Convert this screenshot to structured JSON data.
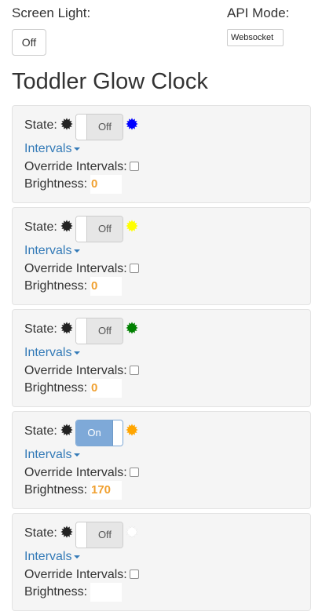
{
  "header": {
    "screen_light_label": "Screen Light:",
    "screen_light_value": "Off",
    "api_mode_label": "API Mode:",
    "api_mode_value": "Websocket"
  },
  "title": "Toddler Glow Clock",
  "labels": {
    "state": "State:",
    "intervals": "Intervals",
    "override": "Override Intervals:",
    "brightness": "Brightness:"
  },
  "icons": {
    "state_icon": "sun-icon",
    "color_icon": "color-sun-icon",
    "dropdown_icon": "caret-down-icon"
  },
  "lights": [
    {
      "state": "Off",
      "on": false,
      "color": "#0000ff",
      "override": false,
      "brightness": "0"
    },
    {
      "state": "Off",
      "on": false,
      "color": "#ffff00",
      "override": false,
      "brightness": "0"
    },
    {
      "state": "Off",
      "on": false,
      "color": "#008000",
      "override": false,
      "brightness": "0"
    },
    {
      "state": "On",
      "on": true,
      "color": "#ffa500",
      "override": false,
      "brightness": "170"
    },
    {
      "state": "Off",
      "on": false,
      "color": "#ffffff",
      "override": false,
      "brightness": ""
    }
  ]
}
